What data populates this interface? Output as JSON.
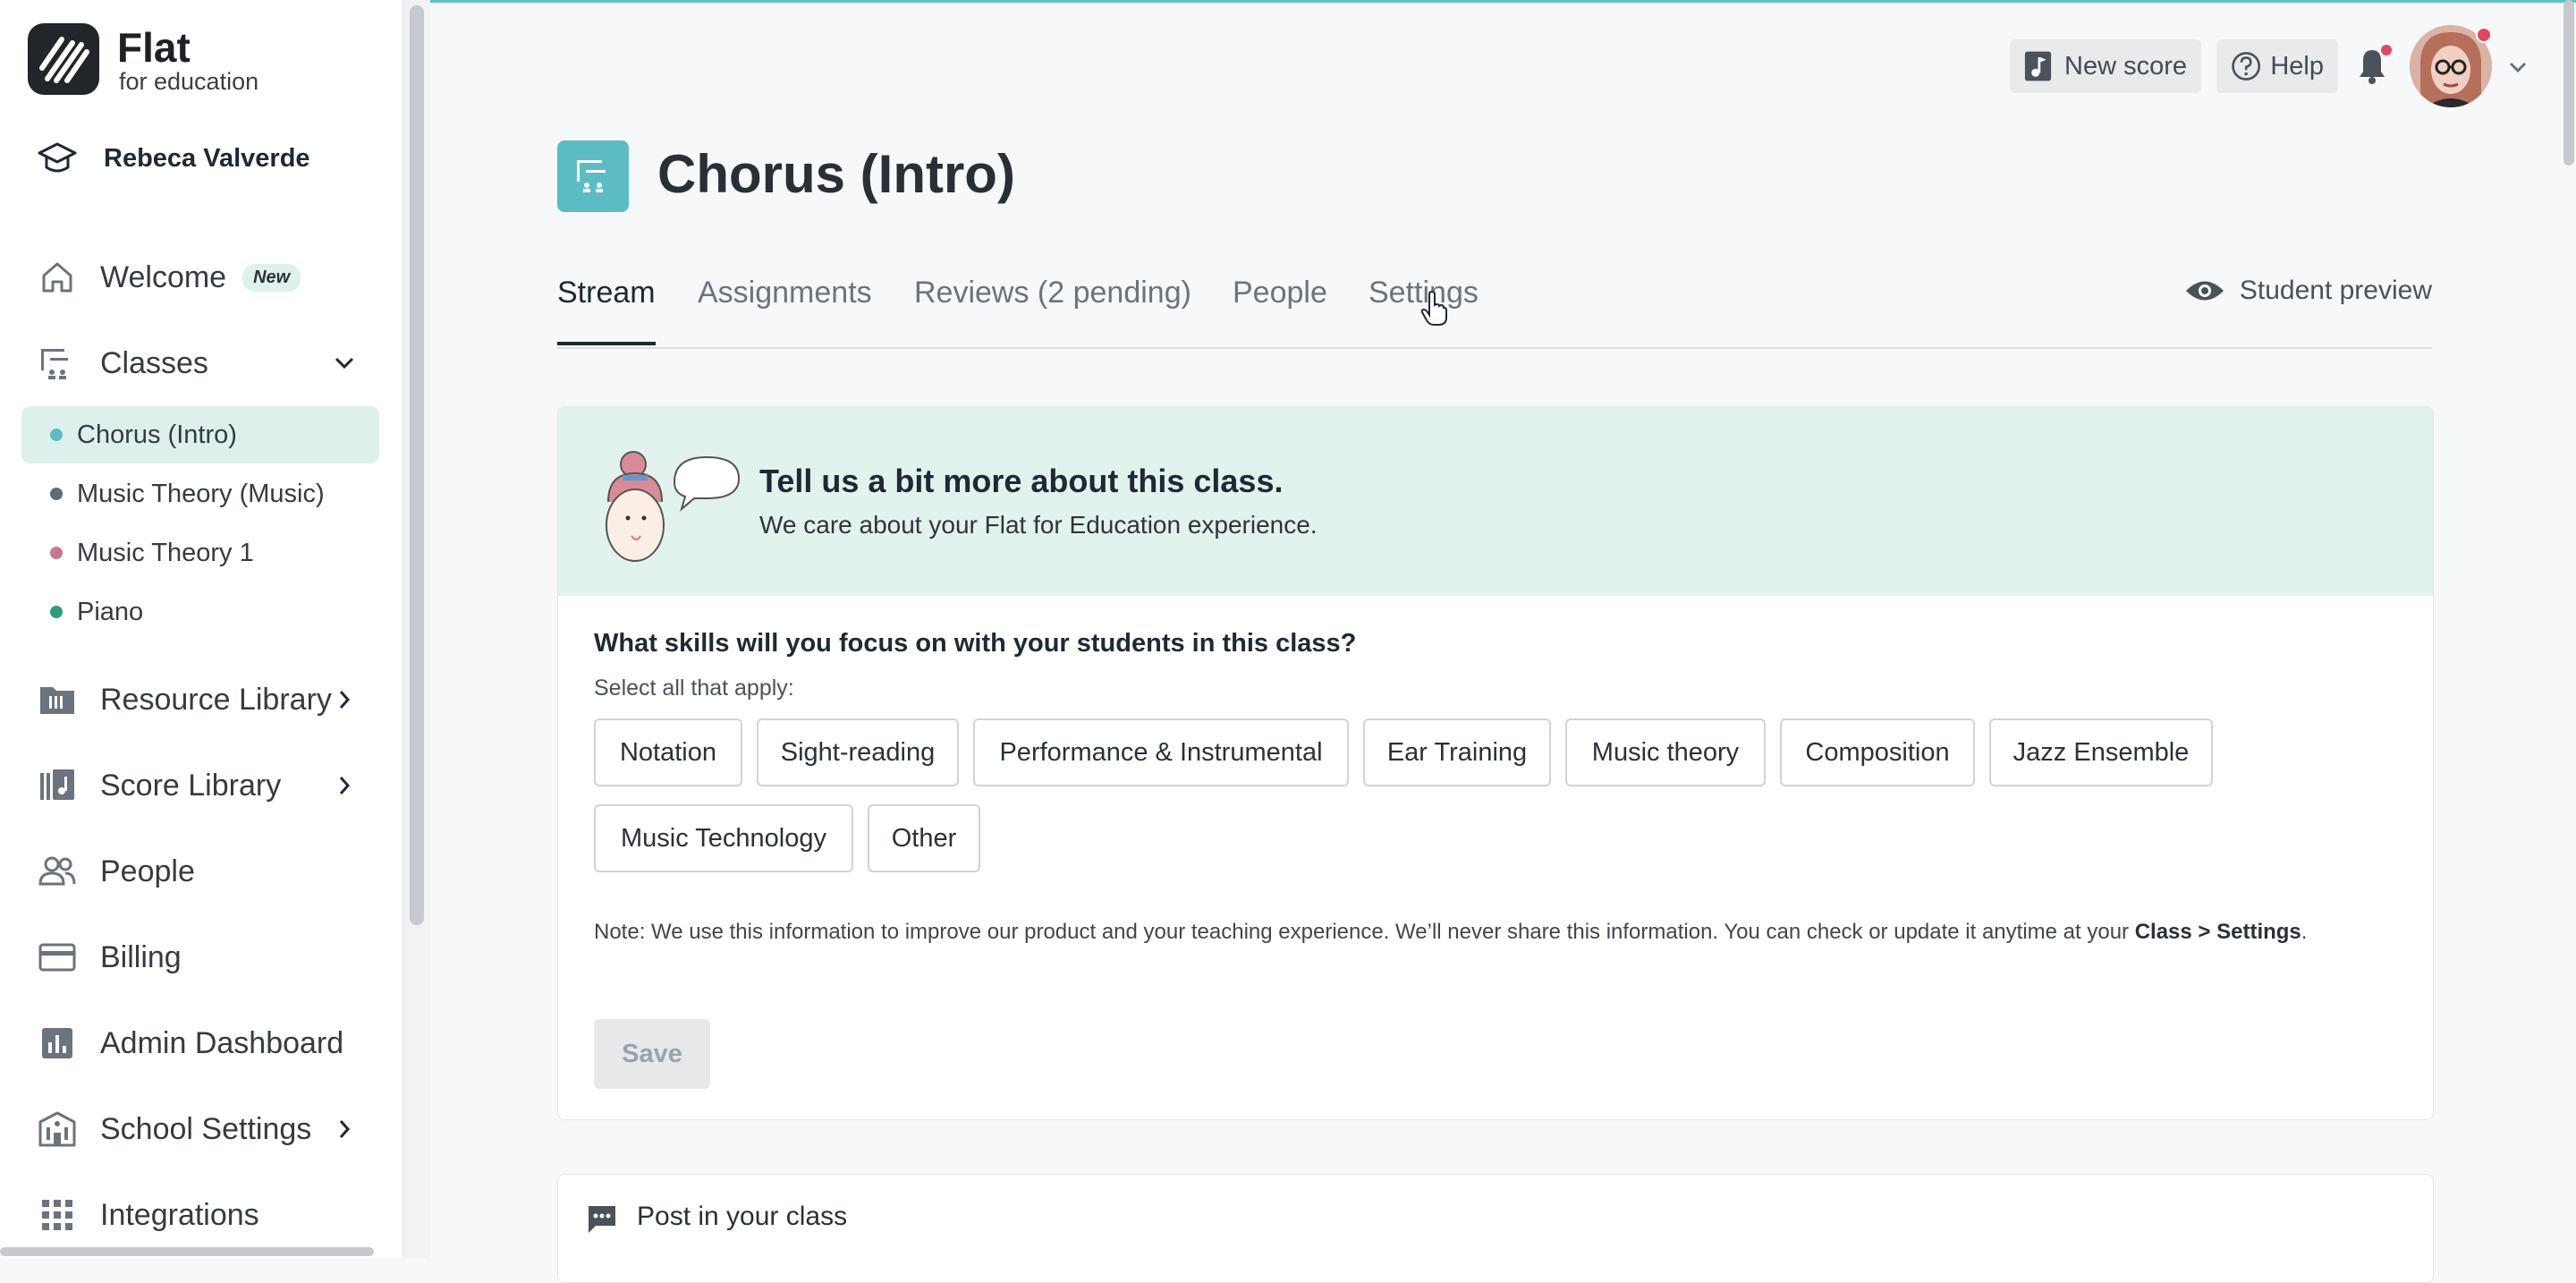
{
  "brand": {
    "name": "Flat",
    "tagline": "for education"
  },
  "user": {
    "name": "Rebeca Valverde"
  },
  "sidebar": {
    "welcome": {
      "label": "Welcome",
      "badge": "New"
    },
    "classes": {
      "label": "Classes"
    },
    "class_list": [
      {
        "label": "Chorus (Intro)",
        "dot": "#5cbcc3",
        "active": true
      },
      {
        "label": "Music Theory (Music)",
        "dot": "#5c6b80",
        "active": false
      },
      {
        "label": "Music Theory 1",
        "dot": "#c9788c",
        "active": false
      },
      {
        "label": "Piano",
        "dot": "#2e9d7e",
        "active": false
      }
    ],
    "resource_library": "Resource Library",
    "score_library": "Score Library",
    "people": "People",
    "billing": "Billing",
    "admin_dashboard": "Admin Dashboard",
    "school_settings": "School Settings",
    "integrations": "Integrations"
  },
  "topbar": {
    "new_score": "New score",
    "help": "Help"
  },
  "page": {
    "title": "Chorus (Intro)"
  },
  "tabs": {
    "stream": "Stream",
    "assignments": "Assignments",
    "reviews": "Reviews (2 pending)",
    "people": "People",
    "settings": "Settings",
    "student_preview": "Student preview"
  },
  "survey": {
    "title": "Tell us a bit more about this class.",
    "subtitle": "We care about your Flat for Education experience.",
    "question": "What skills will you focus on with your students in this class?",
    "hint": "Select all that apply:",
    "options": [
      "Notation",
      "Sight-reading",
      "Performance & Instrumental",
      "Ear Training",
      "Music theory",
      "Composition",
      "Jazz Ensemble",
      "Music Technology",
      "Other"
    ],
    "note_text": "Note: We use this information to improve our product and your teaching experience. We’ll never share this information. You can check or update it anytime at your ",
    "note_bold": "Class > Settings",
    "note_end": ".",
    "save": "Save"
  },
  "post": {
    "label": "Post in your class"
  },
  "colors": {
    "accent": "#5cbcc3",
    "banner": "#e2f2ec",
    "active_class": "#def0ec",
    "notification": "#e2475d"
  }
}
